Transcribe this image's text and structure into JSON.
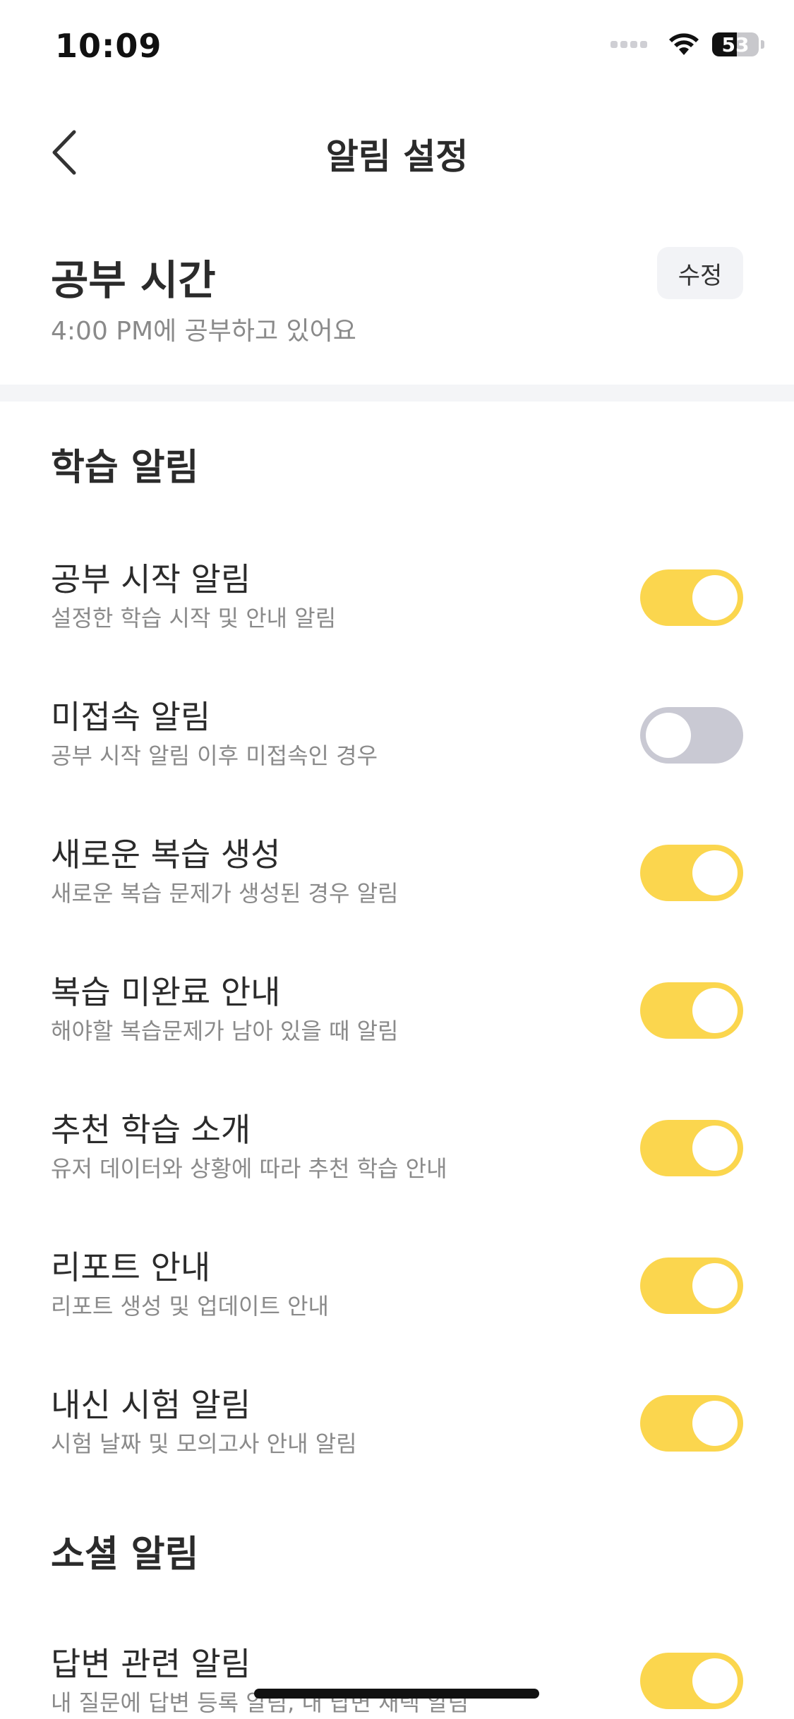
{
  "status_bar": {
    "time": "10:09",
    "battery_level": "53",
    "battery_fraction": 0.53
  },
  "nav": {
    "title": "알림 설정",
    "back_icon": "chevron-left-icon"
  },
  "study_time": {
    "title": "공부 시간",
    "subtitle": "4:00 PM에 공부하고 있어요",
    "edit_label": "수정"
  },
  "learning_section": {
    "title": "학습 알림",
    "items": [
      {
        "title": "공부 시작 알림",
        "desc": "설정한 학습 시작 및 안내 알림",
        "on": true
      },
      {
        "title": "미접속 알림",
        "desc": "공부 시작 알림 이후 미접속인 경우",
        "on": false
      },
      {
        "title": "새로운 복습 생성",
        "desc": "새로운 복습 문제가 생성된 경우 알림",
        "on": true
      },
      {
        "title": "복습 미완료 안내",
        "desc": "해야할 복습문제가 남아 있을 때 알림",
        "on": true
      },
      {
        "title": "추천 학습 소개",
        "desc": "유저 데이터와 상황에 따라 추천 학습 안내",
        "on": true
      },
      {
        "title": "리포트 안내",
        "desc": "리포트 생성 및 업데이트 안내",
        "on": true
      },
      {
        "title": "내신 시험 알림",
        "desc": "시험 날짜 및 모의고사 안내 알림",
        "on": true
      }
    ]
  },
  "social_section": {
    "title": "소셜 알림",
    "items": [
      {
        "title": "답변 관련 알림",
        "desc": "내 질문에 답변 등록 알림, 내 답변 채택 알림",
        "on": true
      }
    ]
  },
  "colors": {
    "toggle_on": "#fbd64e",
    "toggle_off": "#c9c9d3",
    "divider": "#f4f5f7"
  }
}
